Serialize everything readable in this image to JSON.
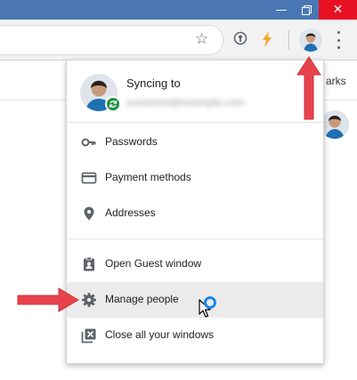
{
  "window": {
    "controls": [
      "minimize-icon",
      "restore-icon",
      "close-icon"
    ],
    "close_color": "#e81123",
    "titlebar_color": "#4a77b4"
  },
  "toolbar": {
    "icons": [
      "star-icon",
      "extension-icon",
      "lightning-extension-icon",
      "profile-avatar",
      "more-vert-icon"
    ]
  },
  "bookmarks_bar": {
    "visible_text": "arks"
  },
  "profile_menu": {
    "sync_title": "Syncing to",
    "sync_email": "someone@example.com",
    "items": [
      {
        "label": "Passwords",
        "icon": "key-icon"
      },
      {
        "label": "Payment methods",
        "icon": "credit-card-icon"
      },
      {
        "label": "Addresses",
        "icon": "location-pin-icon"
      },
      {
        "label": "Open Guest window",
        "icon": "guest-badge-icon"
      },
      {
        "label": "Manage people",
        "icon": "gear-icon",
        "highlighted": true
      },
      {
        "label": "Close all your windows",
        "icon": "close-windows-icon"
      }
    ]
  },
  "annotations": {
    "arrow_color": "#e8434c",
    "loading_ring_color": "#1e88e5"
  }
}
